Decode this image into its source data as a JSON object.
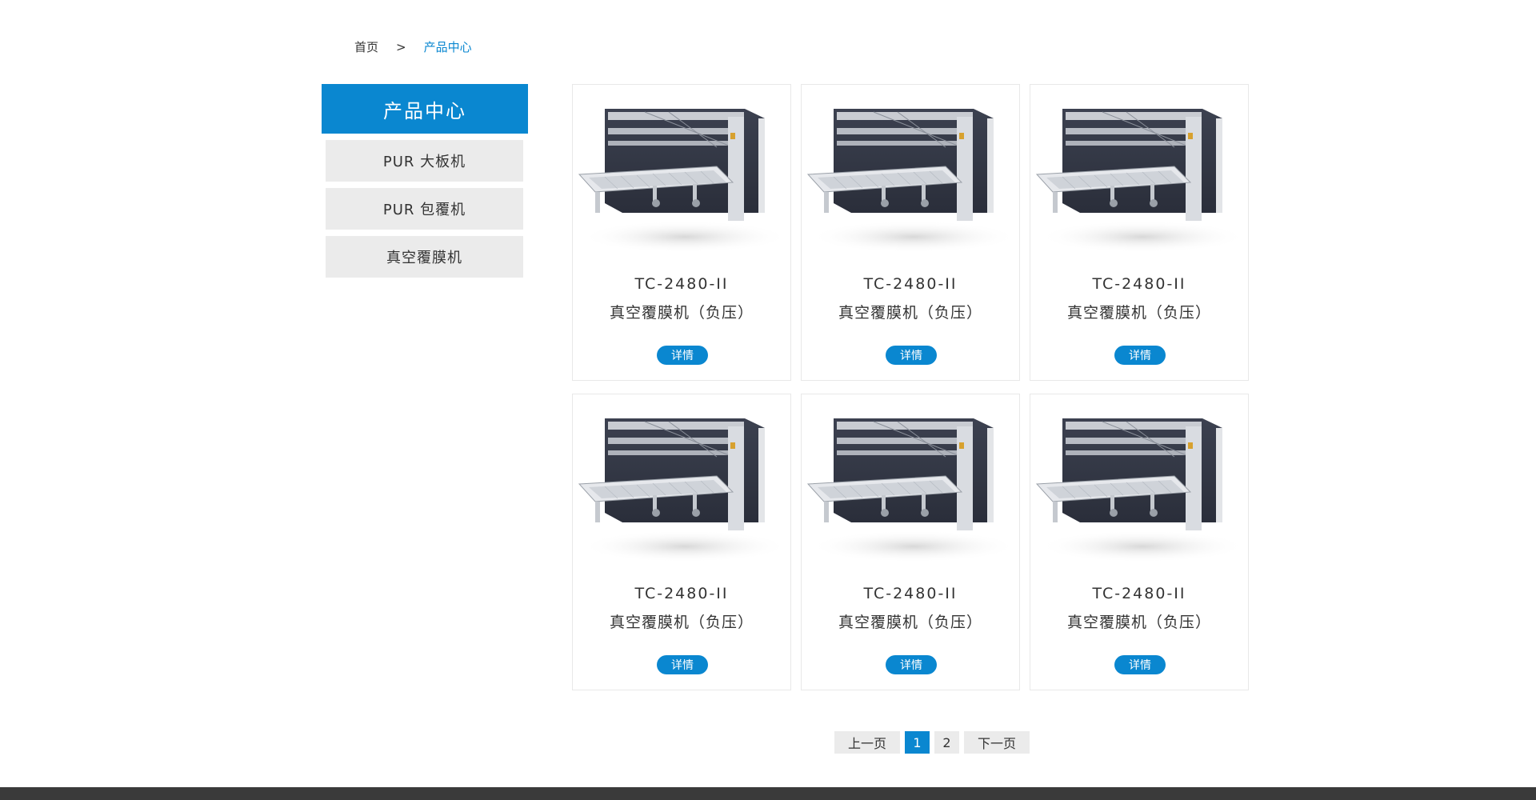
{
  "breadcrumb": {
    "home": "首页",
    "separator": ">",
    "current": "产品中心"
  },
  "sidebar": {
    "title": "产品中心",
    "items": [
      {
        "label": "PUR 大板机"
      },
      {
        "label": "PUR 包覆机"
      },
      {
        "label": "真空覆膜机"
      }
    ]
  },
  "products": [
    {
      "model": "TC-2480-II",
      "name": "真空覆膜机（负压）",
      "button": "详情"
    },
    {
      "model": "TC-2480-II",
      "name": "真空覆膜机（负压）",
      "button": "详情"
    },
    {
      "model": "TC-2480-II",
      "name": "真空覆膜机（负压）",
      "button": "详情"
    },
    {
      "model": "TC-2480-II",
      "name": "真空覆膜机（负压）",
      "button": "详情"
    },
    {
      "model": "TC-2480-II",
      "name": "真空覆膜机（负压）",
      "button": "详情"
    },
    {
      "model": "TC-2480-II",
      "name": "真空覆膜机（负压）",
      "button": "详情"
    }
  ],
  "pagination": {
    "prev": "上一页",
    "pages": [
      "1",
      "2"
    ],
    "current_page": "1",
    "next": "下一页"
  },
  "colors": {
    "accent": "#0a87d0",
    "sidebar_item_bg": "#ebebeb",
    "footer": "#3a3a3a"
  }
}
